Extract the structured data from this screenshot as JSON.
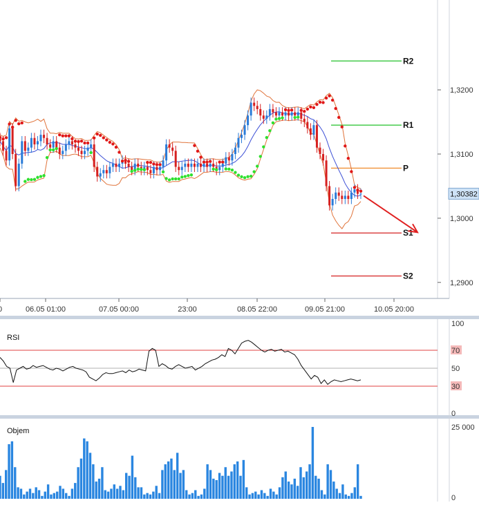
{
  "chart_data": [
    {
      "type": "candlestick",
      "title": "",
      "x_tick_labels": [
        "0",
        "06.05 01:00",
        "07.05 00:00",
        "23:00",
        "08.05 22:00",
        "09.05 21:00",
        "10.05 20:00"
      ],
      "y_tick_labels": [
        "1,3200",
        "1,3100",
        "1,3000",
        "1,2900"
      ],
      "y_range": [
        1.2875,
        1.334
      ],
      "current_price": "1,30382",
      "pivot_levels": [
        {
          "label": "R2",
          "value": 1.3245,
          "color": "#22c02a"
        },
        {
          "label": "R1",
          "value": 1.3145,
          "color": "#22c02a"
        },
        {
          "label": "P",
          "value": 1.3078,
          "color": "#f08a2a"
        },
        {
          "label": "S1",
          "value": 1.2977,
          "color": "#d42020"
        },
        {
          "label": "S2",
          "value": 1.291,
          "color": "#d42020"
        }
      ],
      "forecast_arrow": {
        "from": [
          130,
          1.3035
        ],
        "to": [
          155,
          1.2978
        ],
        "color": "#e02020"
      },
      "close": [
        1.312,
        1.3105,
        1.309,
        1.314,
        1.31,
        1.305,
        1.3085,
        1.312,
        1.3105,
        1.311,
        1.3125,
        1.3115,
        1.312,
        1.313,
        1.3125,
        1.3115,
        1.311,
        1.312,
        1.311,
        1.31,
        1.3105,
        1.3115,
        1.312,
        1.3115,
        1.311,
        1.3105,
        1.31,
        1.3105,
        1.311,
        1.3115,
        1.308,
        1.3065,
        1.307,
        1.3075,
        1.307,
        1.308,
        1.3085,
        1.308,
        1.3085,
        1.309,
        1.3085,
        1.308,
        1.3075,
        1.3085,
        1.308,
        1.3075,
        1.308,
        1.3075,
        1.307,
        1.308,
        1.3075,
        1.308,
        1.309,
        1.3115,
        1.311,
        1.3105,
        1.308,
        1.3075,
        1.308,
        1.3085,
        1.308,
        1.3085,
        1.308,
        1.3085,
        1.308,
        1.3085,
        1.308,
        1.3085,
        1.308,
        1.3075,
        1.308,
        1.3085,
        1.3095,
        1.309,
        1.31,
        1.311,
        1.3125,
        1.313,
        1.3145,
        1.316,
        1.318,
        1.3175,
        1.317,
        1.316,
        1.3155,
        1.316,
        1.317,
        1.3165,
        1.316,
        1.3165,
        1.316,
        1.3165,
        1.316,
        1.3165,
        1.316,
        1.3165,
        1.3155,
        1.315,
        1.314,
        1.313,
        1.3145,
        1.311,
        1.31,
        1.309,
        1.305,
        1.302,
        1.303,
        1.304,
        1.3035,
        1.303,
        1.3035,
        1.303,
        1.304,
        1.3045,
        1.3038,
        1.30382
      ],
      "volume": [
        8000,
        5500,
        10000,
        19000,
        20000,
        11000,
        4000,
        3500,
        1500,
        2500,
        3500,
        2000,
        4000,
        3000,
        1000,
        2500,
        5000,
        1500,
        2000,
        2500,
        4500,
        3500,
        2000,
        1000,
        3500,
        5500,
        11000,
        14000,
        21000,
        20000,
        16000,
        12000,
        6000,
        7000,
        11000,
        3000,
        2500,
        3500,
        5000,
        3500,
        4500,
        3000,
        9000,
        8000,
        15000,
        7500,
        4000,
        4000,
        1500,
        2000,
        1500,
        2500,
        4500,
        2000,
        10000,
        12000,
        13000,
        14000,
        10000,
        16000,
        9000,
        10000,
        3000,
        1500,
        2000,
        3000,
        1000,
        1500,
        3500,
        12000,
        10000,
        7000,
        6500,
        9000,
        8000,
        11000,
        8000,
        9500,
        12000,
        13000,
        8000,
        13500,
        4000,
        1500,
        2000,
        2500,
        1500,
        3000,
        2000,
        1000,
        3500,
        2500,
        1500,
        4000,
        7500,
        9500,
        6000,
        5000,
        7000,
        4500,
        11000,
        7500,
        9500,
        12000,
        25000,
        8000,
        7000,
        3000,
        1500,
        12000,
        10000,
        6000,
        3500,
        2000,
        5000,
        1500,
        1000,
        2000,
        4000,
        12000,
        1000
      ],
      "rsi": [
        62,
        58,
        52,
        50,
        34,
        48,
        50,
        52,
        49,
        50,
        53,
        51,
        52,
        53,
        51,
        49,
        48,
        50,
        49,
        47,
        49,
        51,
        52,
        50,
        49,
        48,
        46,
        40,
        38,
        36,
        39,
        43,
        45,
        44,
        44,
        45,
        46,
        47,
        45,
        48,
        46,
        47,
        49,
        48,
        47,
        69,
        72,
        70,
        52,
        55,
        53,
        50,
        49,
        52,
        54,
        52,
        50,
        51,
        52,
        48,
        50,
        52,
        55,
        57,
        59,
        60,
        62,
        65,
        63,
        72,
        70,
        66,
        72,
        78,
        80,
        81,
        79,
        76,
        73,
        70,
        68,
        70,
        71,
        69,
        70,
        71,
        68,
        69,
        67,
        65,
        60,
        53,
        48,
        43,
        38,
        42,
        40,
        33,
        37,
        32,
        35,
        37,
        36,
        35,
        36,
        37,
        38,
        37,
        36,
        37
      ]
    }
  ],
  "indicators": {
    "rsi_label": "RSI",
    "rsi_ticks": [
      "100",
      "70",
      "50",
      "30",
      "0"
    ],
    "volume_label": "Objem",
    "volume_ticks": [
      "25 000",
      "0"
    ]
  }
}
